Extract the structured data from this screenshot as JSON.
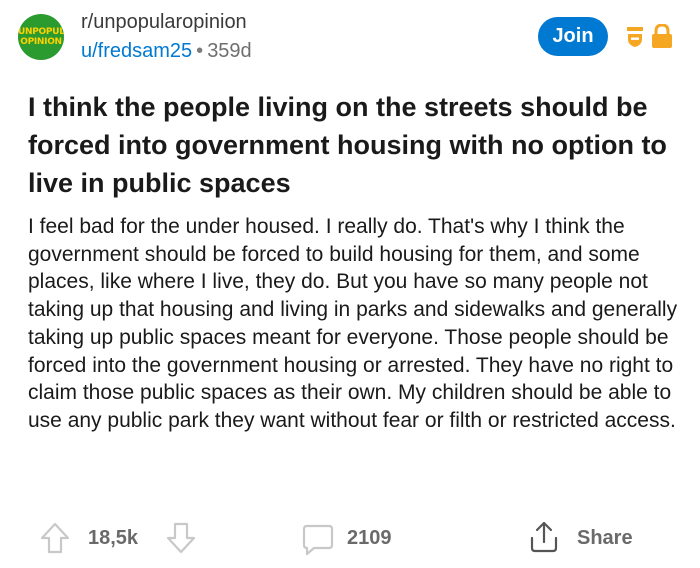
{
  "subreddit": {
    "name": "r/unpopularopinion",
    "avatar_text": [
      "UNPOPULAR",
      "OPINION"
    ],
    "avatar_color": "#2b9a2f"
  },
  "post_meta": {
    "user": "u/fredsam25",
    "separator": "•",
    "age": "359d"
  },
  "header": {
    "join_label": "Join",
    "icons": [
      "mod-shield-icon",
      "lock-icon"
    ],
    "icon_colors": {
      "mod": "#f5a623",
      "lock": "#f5a623"
    }
  },
  "post": {
    "title": "I think the people living on the streets should be forced into government housing with no option to live in public spaces",
    "body": "I feel bad for the under housed. I really do. That's why I think the government should be forced to build housing for them, and some places, like where I live, they do. But you have so many people not taking up that housing and living in parks and sidewalks and generally taking up public spaces meant for everyone. Those people should be forced into the government housing or arrested. They have no right to claim those public spaces as their own. My children should be able to use any public park they want without fear or filth or restricted access."
  },
  "actions": {
    "votes": "18,5k",
    "comments": "2109",
    "share_label": "Share",
    "icons": [
      "upvote-icon",
      "downvote-icon",
      "comment-icon",
      "share-icon"
    ]
  },
  "colors": {
    "accent": "#0079d3",
    "text": "#1a1a1b",
    "muted": "#6a6a6a"
  }
}
